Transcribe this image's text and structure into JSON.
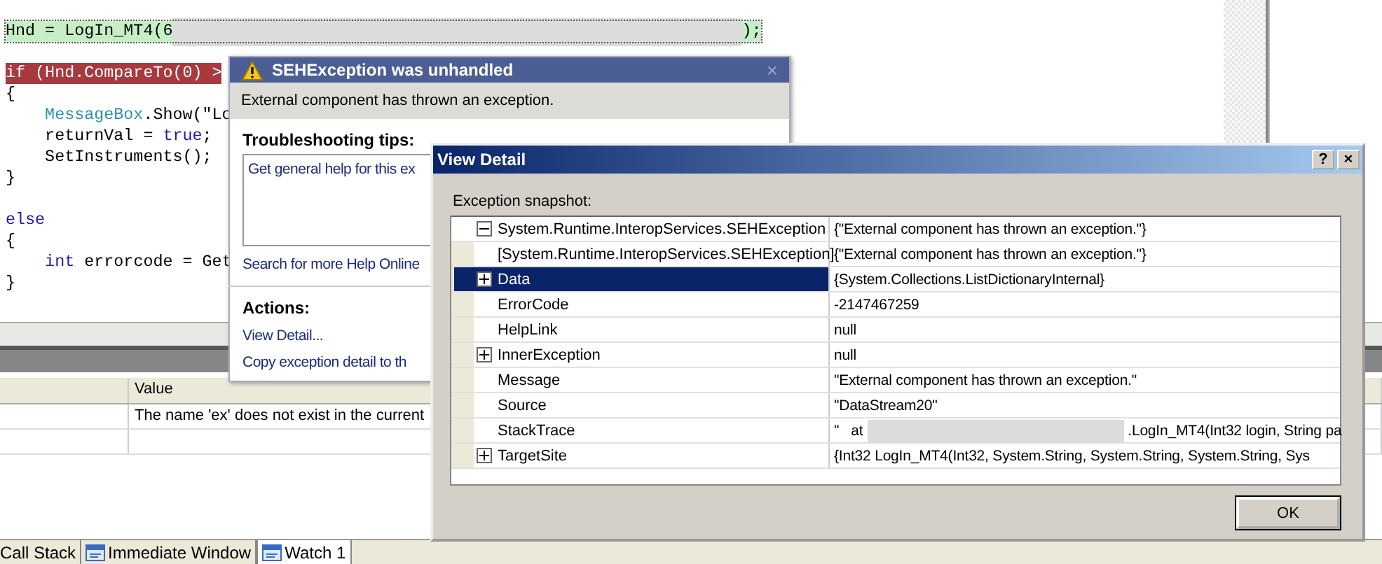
{
  "editor": {
    "blocks": [
      {
        "lines": [
          {
            "kind": "current",
            "segments": [
              {
                "kind": "plain",
                "text": "Hnd = LogIn_MT4(6"
              },
              {
                "kind": "redacted"
              },
              {
                "kind": "plain",
                "text": ");"
              }
            ]
          }
        ]
      },
      {
        "lines": [
          {
            "kind": "error",
            "segments": [
              {
                "kind": "plain",
                "text": "if (Hnd.CompareTo(0) >"
              }
            ]
          },
          {
            "kind": "plain",
            "segments": [
              {
                "kind": "plain",
                "text": "{"
              }
            ]
          },
          {
            "kind": "plain",
            "segments": [
              {
                "kind": "type",
                "text": "    MessageBox"
              },
              {
                "kind": "plain",
                "text": ".Show(\"Lo"
              }
            ]
          },
          {
            "kind": "plain",
            "segments": [
              {
                "kind": "plain",
                "text": "    returnVal = "
              },
              {
                "kind": "keyword",
                "text": "true"
              },
              {
                "kind": "plain",
                "text": ";"
              }
            ]
          },
          {
            "kind": "plain",
            "segments": [
              {
                "kind": "plain",
                "text": "    SetInstruments();"
              }
            ]
          },
          {
            "kind": "plain",
            "segments": [
              {
                "kind": "plain",
                "text": "}"
              }
            ]
          }
        ]
      },
      {
        "lines": [
          {
            "kind": "plain",
            "segments": [
              {
                "kind": "keyword",
                "text": "else"
              }
            ]
          },
          {
            "kind": "plain",
            "segments": [
              {
                "kind": "plain",
                "text": "{"
              }
            ]
          },
          {
            "kind": "plain",
            "segments": [
              {
                "kind": "keyword",
                "text": "    int"
              },
              {
                "kind": "plain",
                "text": " errorcode = Get"
              }
            ]
          },
          {
            "kind": "plain",
            "segments": [
              {
                "kind": "plain",
                "text": "}"
              }
            ]
          }
        ]
      }
    ]
  },
  "watch": {
    "value_header": "Value",
    "rows": [
      {
        "value": "The name 'ex' does not exist in the current"
      }
    ]
  },
  "bottom_tabs": [
    {
      "label": "Call Stack",
      "icon": false,
      "selected": false
    },
    {
      "label": "Immediate Window",
      "icon": true,
      "selected": false
    },
    {
      "label": "Watch 1",
      "icon": true,
      "selected": true
    }
  ],
  "exception_assistant": {
    "title": "SEHException was unhandled",
    "message": "External component has thrown an exception.",
    "tips_heading": "Troubleshooting tips:",
    "tips": [
      "Get general help for this ex"
    ],
    "search_link": "Search for more Help Online",
    "actions_heading": "Actions:",
    "actions": [
      "View Detail...",
      "Copy exception detail to th"
    ]
  },
  "view_detail": {
    "title": "View Detail",
    "snapshot_label": "Exception snapshot:",
    "tree": [
      {
        "name": "System.Runtime.InteropServices.SEHException",
        "value": [
          "{\"External component has thrown an exception.\"}"
        ],
        "kind": "group",
        "expanded": true,
        "selected": false,
        "children": [
          {
            "name": "[System.Runtime.InteropServices.SEHException]",
            "value": [
              "{\"External component has thrown an exception.\"}"
            ],
            "kind": "leaf",
            "selected": false
          },
          {
            "name": "Data",
            "value": [
              "{System.Collections.ListDictionaryInternal}"
            ],
            "kind": "group",
            "expanded": false,
            "selected": true
          },
          {
            "name": "ErrorCode",
            "value": [
              "-2147467259"
            ],
            "kind": "leaf",
            "selected": false
          },
          {
            "name": "HelpLink",
            "value": [
              "null"
            ],
            "kind": "leaf",
            "selected": false
          },
          {
            "name": "InnerException",
            "value": [
              "null"
            ],
            "kind": "group",
            "expanded": false,
            "selected": false
          },
          {
            "name": "Message",
            "value": [
              "\"External component has thrown an exception.\""
            ],
            "kind": "leaf",
            "selected": false
          },
          {
            "name": "Source",
            "value": [
              "\"DataStream20\""
            ],
            "kind": "leaf",
            "selected": false
          },
          {
            "name": "StackTrace",
            "value": [
              "\"   at",
              ".LogIn_MT4(Int32 login, String pa"
            ],
            "kind": "leaf",
            "selected": false
          },
          {
            "name": "TargetSite",
            "value": [
              "{Int32 LogIn_MT4(Int32, System.String, System.String, System.String, Sys"
            ],
            "kind": "group",
            "expanded": false,
            "selected": false
          }
        ]
      }
    ],
    "help_button": "?",
    "close_button": "×",
    "ok_button": "OK"
  }
}
